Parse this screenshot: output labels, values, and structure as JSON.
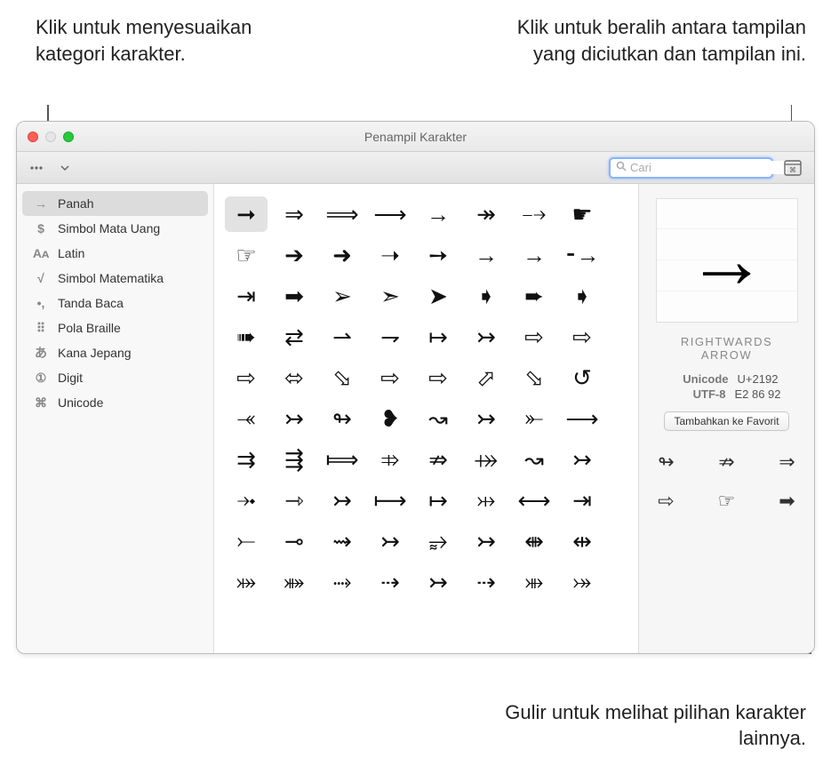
{
  "callouts": {
    "top_left": "Klik untuk menyesuaikan kategori karakter.",
    "top_right": "Klik untuk beralih antara tampilan yang diciutkan dan tampilan ini.",
    "bottom_right": "Gulir untuk melihat pilihan karakter lainnya."
  },
  "window": {
    "title": "Penampil Karakter"
  },
  "toolbar": {
    "settings_icon": "settings",
    "dropdown_icon": "chevron-down",
    "collapse_icon": "collapse-view"
  },
  "search": {
    "placeholder": "Cari",
    "value": ""
  },
  "sidebar": {
    "items": [
      {
        "icon": "→",
        "label": "Panah",
        "selected": true
      },
      {
        "icon": "$",
        "label": "Simbol Mata Uang"
      },
      {
        "icon": "Aᴀ",
        "label": "Latin"
      },
      {
        "icon": "√",
        "label": "Simbol Matematika"
      },
      {
        "icon": "•,",
        "label": "Tanda Baca"
      },
      {
        "icon": "⠿",
        "label": "Pola Braille"
      },
      {
        "icon": "あ",
        "label": "Kana Jepang"
      },
      {
        "icon": "①",
        "label": "Digit"
      },
      {
        "icon": "⌘",
        "label": "Unicode"
      }
    ]
  },
  "chars": {
    "rows": [
      [
        "➞",
        "⇒",
        "⟹",
        "⟶",
        "→",
        "↠",
        "⤍",
        "☛"
      ],
      [
        "☞",
        "➔",
        "➜",
        "➝",
        "➙",
        "→",
        "→",
        "⁃→"
      ],
      [
        "⇥",
        "➡",
        "➢",
        "➣",
        "➤",
        "➧",
        "➨",
        "➧"
      ],
      [
        "➠",
        "⇄",
        "⇀",
        "⇁",
        "↦",
        "↣",
        "⇨",
        "⇨"
      ],
      [
        "⇨",
        "⬄",
        "⬂",
        "⇨",
        "⇨",
        "⬀",
        "⬂",
        "↺"
      ],
      [
        "⤛",
        "↣",
        "↬",
        "❥",
        "↝",
        "↣",
        "⤜",
        "⟶"
      ],
      [
        "⇉",
        "⇶",
        "⟾",
        "⤃",
        "⇏",
        "⤀",
        "↝",
        "↣"
      ],
      [
        "⤞",
        "⇾",
        "↣",
        "⟼",
        "↦",
        "⤔",
        "⟷",
        "⇥"
      ],
      [
        "⤚",
        "⊸",
        "⇝",
        "↣",
        "⥵",
        "↣",
        "⇼",
        "⇹"
      ],
      [
        "⤗",
        "⤘",
        "⤑",
        "⇢",
        "↣",
        "⇢",
        "⤕",
        "⤖"
      ]
    ]
  },
  "detail": {
    "glyph": "→",
    "name_line1": "RIGHTWARDS",
    "name_line2": "ARROW",
    "unicode_label": "Unicode",
    "unicode_value": "U+2192",
    "utf8_label": "UTF-8",
    "utf8_value": "E2 86 92",
    "favorite_button": "Tambahkan ke Favorit",
    "variants": [
      "↬",
      "⇏",
      "⇒",
      "⇨",
      "☞",
      "➡"
    ]
  }
}
